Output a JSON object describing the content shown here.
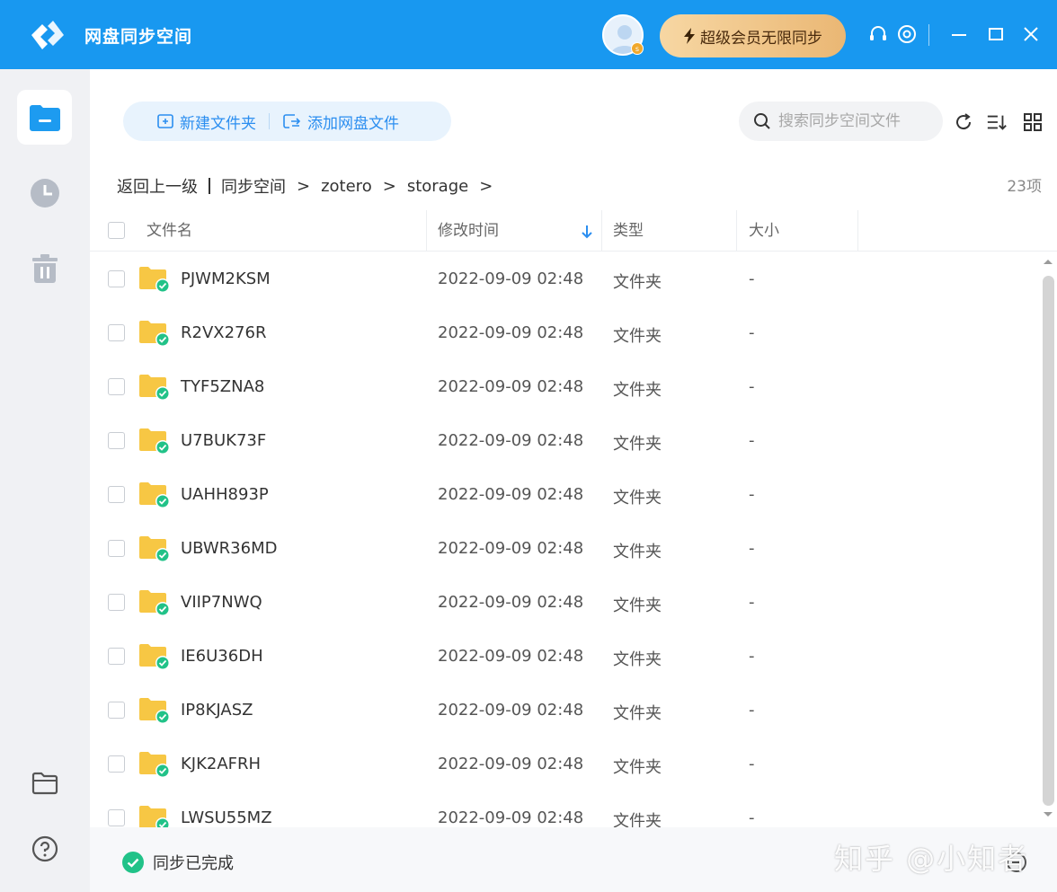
{
  "app": {
    "title": "网盘同步空间",
    "vip_label": "超级会员无限同步",
    "avatar_badge": "s"
  },
  "toolbar": {
    "new_folder": "新建文件夹",
    "add_files": "添加网盘文件",
    "search_placeholder": "搜索同步空间文件"
  },
  "breadcrumb": {
    "back": "返回上一级",
    "items": [
      "同步空间",
      "zotero",
      "storage"
    ]
  },
  "count_label": "23项",
  "columns": {
    "name": "文件名",
    "modified": "修改时间",
    "type": "类型",
    "size": "大小"
  },
  "sort": {
    "column": "modified",
    "direction": "desc"
  },
  "rows": [
    {
      "name": "PJWM2KSM",
      "modified": "2022-09-09 02:48",
      "type": "文件夹",
      "size": "-"
    },
    {
      "name": "R2VX276R",
      "modified": "2022-09-09 02:48",
      "type": "文件夹",
      "size": "-"
    },
    {
      "name": "TYF5ZNA8",
      "modified": "2022-09-09 02:48",
      "type": "文件夹",
      "size": "-"
    },
    {
      "name": "U7BUK73F",
      "modified": "2022-09-09 02:48",
      "type": "文件夹",
      "size": "-"
    },
    {
      "name": "UAHH893P",
      "modified": "2022-09-09 02:48",
      "type": "文件夹",
      "size": "-"
    },
    {
      "name": "UBWR36MD",
      "modified": "2022-09-09 02:48",
      "type": "文件夹",
      "size": "-"
    },
    {
      "name": "VIIP7NWQ",
      "modified": "2022-09-09 02:48",
      "type": "文件夹",
      "size": "-"
    },
    {
      "name": "IE6U36DH",
      "modified": "2022-09-09 02:48",
      "type": "文件夹",
      "size": "-"
    },
    {
      "name": "IP8KJASZ",
      "modified": "2022-09-09 02:48",
      "type": "文件夹",
      "size": "-"
    },
    {
      "name": "KJK2AFRH",
      "modified": "2022-09-09 02:48",
      "type": "文件夹",
      "size": "-"
    },
    {
      "name": "LWSU55MZ",
      "modified": "2022-09-09 02:48",
      "type": "文件夹",
      "size": "-"
    }
  ],
  "status": {
    "sync_label": "同步已完成"
  },
  "watermark": "知乎 @小知者",
  "colors": {
    "titlebar": "#1898f0",
    "accent": "#2b8ef0",
    "folder": "#f7c744",
    "synced": "#21c288"
  }
}
